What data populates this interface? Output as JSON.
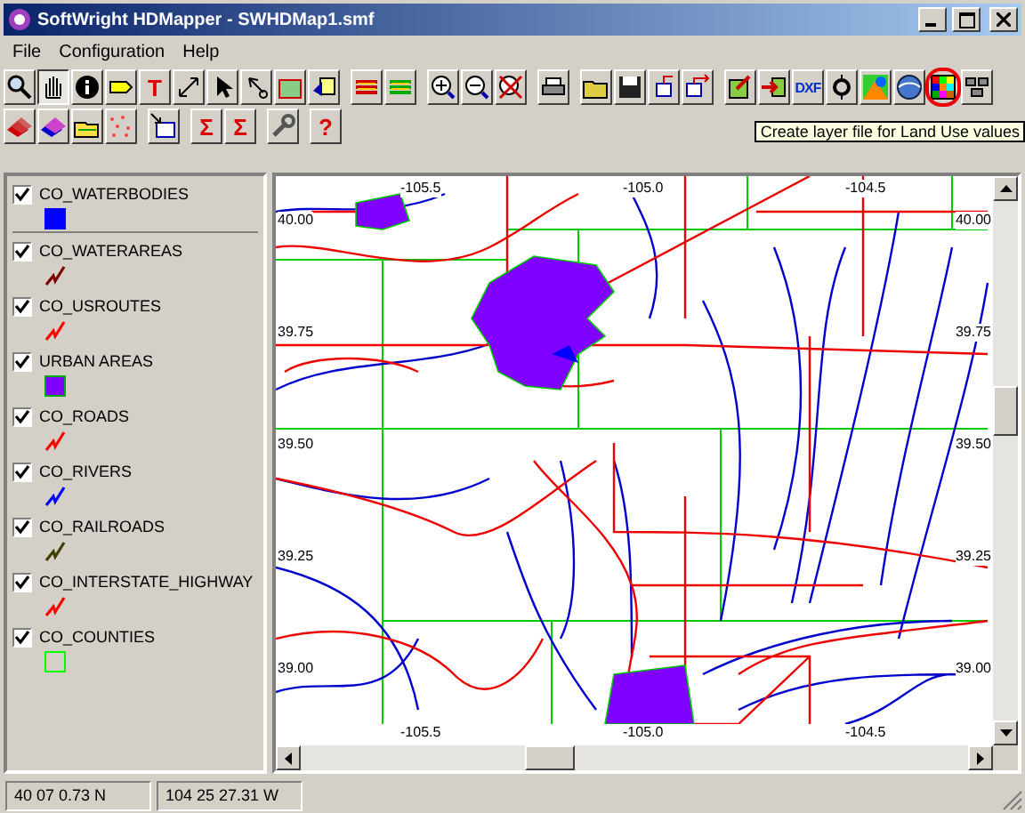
{
  "window": {
    "title": "SoftWright HDMapper - SWHDMap1.smf"
  },
  "menu": [
    "File",
    "Configuration",
    "Help"
  ],
  "toolbar_rows": [
    [
      [
        {
          "kind": "icon",
          "pressed": false,
          "highlighted": false
        },
        {
          "kind": "icon",
          "pressed": true,
          "highlighted": false
        },
        {
          "kind": "icon",
          "pressed": false,
          "highlighted": false
        },
        {
          "kind": "icon",
          "pressed": false,
          "highlighted": false
        },
        {
          "kind": "text",
          "label": "T",
          "pressed": false,
          "highlighted": false
        },
        {
          "kind": "icon",
          "pressed": false,
          "highlighted": false
        },
        {
          "kind": "icon",
          "pressed": false,
          "highlighted": false
        },
        {
          "kind": "icon",
          "pressed": false,
          "highlighted": false
        },
        {
          "kind": "icon",
          "pressed": false,
          "highlighted": false
        },
        {
          "kind": "icon",
          "pressed": false,
          "highlighted": false
        }
      ],
      [
        {
          "kind": "icon",
          "pressed": false,
          "highlighted": false
        },
        {
          "kind": "icon",
          "pressed": false,
          "highlighted": false
        }
      ],
      [
        {
          "kind": "icon",
          "pressed": false,
          "highlighted": false
        },
        {
          "kind": "icon",
          "pressed": false,
          "highlighted": false
        },
        {
          "kind": "icon",
          "pressed": false,
          "highlighted": false
        }
      ],
      [
        {
          "kind": "icon",
          "pressed": false,
          "highlighted": false
        }
      ],
      [
        {
          "kind": "icon",
          "pressed": false,
          "highlighted": false
        },
        {
          "kind": "icon",
          "pressed": false,
          "highlighted": false
        },
        {
          "kind": "icon",
          "pressed": false,
          "highlighted": false
        },
        {
          "kind": "icon",
          "pressed": false,
          "highlighted": false
        }
      ],
      [
        {
          "kind": "icon",
          "pressed": false,
          "highlighted": false
        },
        {
          "kind": "icon",
          "pressed": false,
          "highlighted": false
        },
        {
          "kind": "text",
          "label": "DXF",
          "pressed": false,
          "highlighted": false
        },
        {
          "kind": "icon",
          "pressed": false,
          "highlighted": false
        },
        {
          "kind": "icon",
          "pressed": false,
          "highlighted": false
        },
        {
          "kind": "icon",
          "pressed": false,
          "highlighted": false
        },
        {
          "kind": "icon",
          "pressed": false,
          "highlighted": true
        },
        {
          "kind": "icon",
          "pressed": false,
          "highlighted": false
        }
      ]
    ],
    [
      [
        {
          "kind": "icon",
          "pressed": false,
          "highlighted": false
        },
        {
          "kind": "icon",
          "pressed": false,
          "highlighted": false
        },
        {
          "kind": "icon",
          "pressed": false,
          "highlighted": false
        },
        {
          "kind": "icon",
          "pressed": false,
          "highlighted": false
        }
      ],
      [
        {
          "kind": "icon",
          "pressed": false,
          "highlighted": false
        }
      ],
      [
        {
          "kind": "text",
          "label": "Σ",
          "pressed": false,
          "highlighted": false
        },
        {
          "kind": "text",
          "label": "Σ",
          "pressed": false,
          "highlighted": false
        }
      ],
      [
        {
          "kind": "icon",
          "pressed": false,
          "highlighted": false
        }
      ],
      [
        {
          "kind": "text",
          "label": "?",
          "pressed": false,
          "highlighted": false
        }
      ]
    ]
  ],
  "tooltip": "Create layer file for Land Use values",
  "layers": [
    {
      "name": "CO_WATERBODIES",
      "checked": true,
      "kind": "fill",
      "color": "#0000ff"
    },
    {
      "name": "CO_WATERAREAS",
      "checked": true,
      "kind": "line",
      "color": "#800000"
    },
    {
      "name": "CO_USROUTES",
      "checked": true,
      "kind": "line",
      "color": "#ff0000"
    },
    {
      "name": "URBAN AREAS",
      "checked": true,
      "kind": "fill",
      "color": "#8000ff"
    },
    {
      "name": "CO_ROADS",
      "checked": true,
      "kind": "line",
      "color": "#ff0000"
    },
    {
      "name": "CO_RIVERS",
      "checked": true,
      "kind": "line",
      "color": "#0000ff"
    },
    {
      "name": "CO_RAILROADS",
      "checked": true,
      "kind": "line",
      "color": "#404000"
    },
    {
      "name": "CO_INTERSTATE_HIGHWAY",
      "checked": true,
      "kind": "line",
      "color": "#ff0000"
    },
    {
      "name": "CO_COUNTIES",
      "checked": true,
      "kind": "outline",
      "color": "#00ff00"
    }
  ],
  "map": {
    "top_labels": [
      "-105.5",
      "-105.0",
      "-104.5"
    ],
    "bottom_labels": [
      "-105.5",
      "-105.0",
      "-104.5"
    ],
    "left_labels": [
      "40.00",
      "39.75",
      "39.50",
      "39.25",
      "39.00"
    ],
    "right_labels": [
      "40.00",
      "39.75",
      "39.50",
      "39.25",
      "39.00"
    ]
  },
  "status_bar": [
    "40 07 0.73 N",
    "104 25 27.31 W"
  ]
}
